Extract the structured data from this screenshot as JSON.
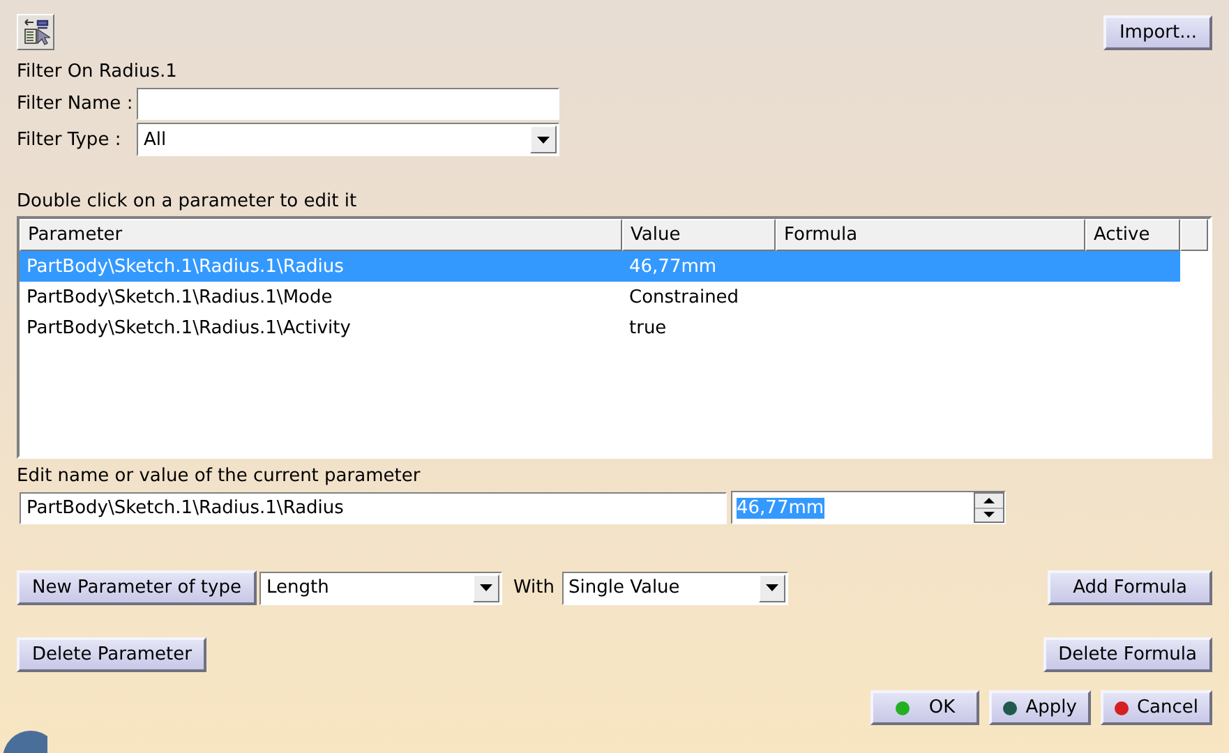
{
  "toolbar": {
    "import_button": "Import..."
  },
  "filter": {
    "title": "Filter On Radius.1",
    "name_label": "Filter Name :",
    "type_label": "Filter Type :",
    "type_value": "All"
  },
  "table": {
    "caption": "Double click on a parameter to edit it",
    "columns": [
      "Parameter",
      "Value",
      "Formula",
      "Active"
    ],
    "rows": [
      {
        "cells": [
          "PartBody\\Sketch.1\\Radius.1\\Radius",
          "46,77mm",
          "",
          ""
        ],
        "selected": true
      },
      {
        "cells": [
          "PartBody\\Sketch.1\\Radius.1\\Mode",
          "Constrained",
          "",
          ""
        ],
        "selected": false
      },
      {
        "cells": [
          "PartBody\\Sketch.1\\Radius.1\\Activity",
          "true",
          "",
          ""
        ],
        "selected": false
      }
    ]
  },
  "editor": {
    "caption": "Edit name or value of the current parameter",
    "name_value": "PartBody\\Sketch.1\\Radius.1\\Radius",
    "value": "46,77mm",
    "value_highlighted": true
  },
  "new_parameter": {
    "button": "New Parameter of type",
    "type_value": "Length",
    "with_label": "With",
    "with_value": "Single Value",
    "add_formula": "Add Formula"
  },
  "delete_row": {
    "delete_parameter": "Delete Parameter",
    "delete_formula": "Delete Formula"
  },
  "dialog_buttons": [
    {
      "label": "OK",
      "color": "#22b022"
    },
    {
      "label": "Apply",
      "color": "#1f5a4a"
    },
    {
      "label": "Cancel",
      "color": "#d42020"
    }
  ]
}
